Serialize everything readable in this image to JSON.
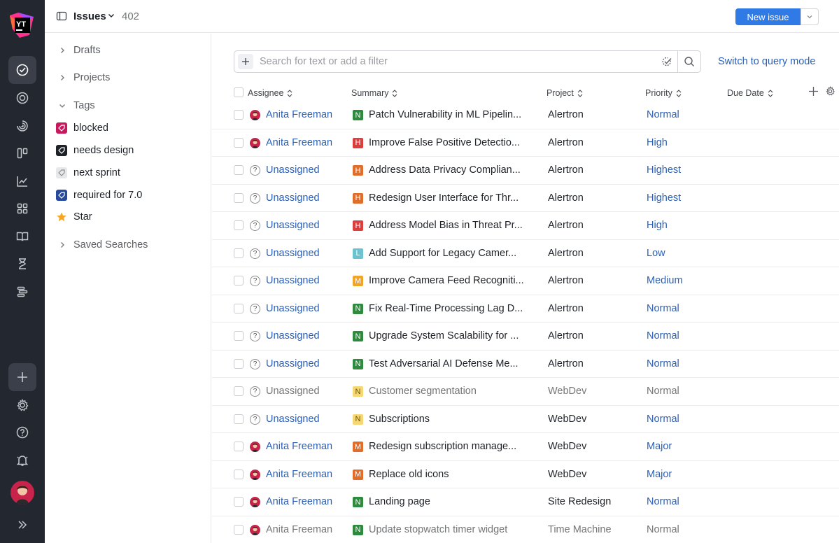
{
  "brand": {
    "logo_text": "YT"
  },
  "header": {
    "title": "Issues",
    "count": "402",
    "new_issue_label": "New issue"
  },
  "sidebar": {
    "drafts": "Drafts",
    "projects": "Projects",
    "tags_label": "Tags",
    "tags": [
      {
        "label": "blocked",
        "color": "#c8195f"
      },
      {
        "label": "needs design",
        "color": "#1f2328"
      },
      {
        "label": "next sprint",
        "color": "#e7e8ea"
      },
      {
        "label": "required for 7.0",
        "color": "#274a9c"
      }
    ],
    "star_label": "Star",
    "saved_searches": "Saved Searches"
  },
  "search": {
    "placeholder": "Search for text or add a filter",
    "query_mode_link": "Switch to query mode"
  },
  "table": {
    "columns": {
      "assignee": "Assignee",
      "summary": "Summary",
      "project": "Project",
      "priority": "Priority",
      "due_date": "Due Date"
    },
    "rows": [
      {
        "assignee": "Anita Freeman",
        "avatar": true,
        "badge": "N",
        "badge_color": "#2e8b3e",
        "summary": "Patch Vulnerability in ML Pipelin...",
        "project": "Alertron",
        "priority": "Normal",
        "resolved": false
      },
      {
        "assignee": "Anita Freeman",
        "avatar": true,
        "badge": "H",
        "badge_color": "#d93f3f",
        "summary": "Improve False Positive Detectio...",
        "project": "Alertron",
        "priority": "High",
        "resolved": false
      },
      {
        "assignee": "Unassigned",
        "avatar": false,
        "badge": "H",
        "badge_color": "#e06d2a",
        "summary": "Address Data Privacy Complian...",
        "project": "Alertron",
        "priority": "Highest",
        "resolved": false
      },
      {
        "assignee": "Unassigned",
        "avatar": false,
        "badge": "H",
        "badge_color": "#e06d2a",
        "summary": "Redesign User Interface for Thr...",
        "project": "Alertron",
        "priority": "Highest",
        "resolved": false
      },
      {
        "assignee": "Unassigned",
        "avatar": false,
        "badge": "H",
        "badge_color": "#d93f3f",
        "summary": "Address Model Bias in Threat Pr...",
        "project": "Alertron",
        "priority": "High",
        "resolved": false
      },
      {
        "assignee": "Unassigned",
        "avatar": false,
        "badge": "L",
        "badge_color": "#6cc2cf",
        "summary": "Add Support for Legacy Camer...",
        "project": "Alertron",
        "priority": "Low",
        "resolved": false
      },
      {
        "assignee": "Unassigned",
        "avatar": false,
        "badge": "M",
        "badge_color": "#f0a52a",
        "summary": "Improve Camera Feed Recogniti...",
        "project": "Alertron",
        "priority": "Medium",
        "resolved": false
      },
      {
        "assignee": "Unassigned",
        "avatar": false,
        "badge": "N",
        "badge_color": "#2e8b3e",
        "summary": "Fix Real-Time Processing Lag D...",
        "project": "Alertron",
        "priority": "Normal",
        "resolved": false
      },
      {
        "assignee": "Unassigned",
        "avatar": false,
        "badge": "N",
        "badge_color": "#2e8b3e",
        "summary": "Upgrade System Scalability for ...",
        "project": "Alertron",
        "priority": "Normal",
        "resolved": false
      },
      {
        "assignee": "Unassigned",
        "avatar": false,
        "badge": "N",
        "badge_color": "#2e8b3e",
        "summary": "Test Adversarial AI Defense Me...",
        "project": "Alertron",
        "priority": "Normal",
        "resolved": false
      },
      {
        "assignee": "Unassigned",
        "avatar": false,
        "badge": "N",
        "badge_color": "#f7d774",
        "summary": "Customer segmentation",
        "project": "WebDev",
        "priority": "Normal",
        "resolved": true
      },
      {
        "assignee": "Unassigned",
        "avatar": false,
        "badge": "N",
        "badge_color": "#f7d774",
        "summary": "Subscriptions",
        "project": "WebDev",
        "priority": "Normal",
        "resolved": false
      },
      {
        "assignee": "Anita Freeman",
        "avatar": true,
        "badge": "M",
        "badge_color": "#e06d2a",
        "summary": "Redesign subscription manage...",
        "project": "WebDev",
        "priority": "Major",
        "resolved": false
      },
      {
        "assignee": "Anita Freeman",
        "avatar": true,
        "badge": "M",
        "badge_color": "#e06d2a",
        "summary": "Replace old icons",
        "project": "WebDev",
        "priority": "Major",
        "resolved": false
      },
      {
        "assignee": "Anita Freeman",
        "avatar": true,
        "badge": "N",
        "badge_color": "#2e8b3e",
        "summary": "Landing page",
        "project": "Site Redesign",
        "priority": "Normal",
        "resolved": false
      },
      {
        "assignee": "Anita Freeman",
        "avatar": true,
        "badge": "N",
        "badge_color": "#2e8b3e",
        "summary": "Update stopwatch timer widget",
        "project": "Time Machine",
        "priority": "Normal",
        "resolved": true
      }
    ]
  },
  "colors": {
    "accent": "#307ae6",
    "link": "#2c5fb4",
    "rail_bg": "#23272f",
    "star": "#f5a623"
  }
}
